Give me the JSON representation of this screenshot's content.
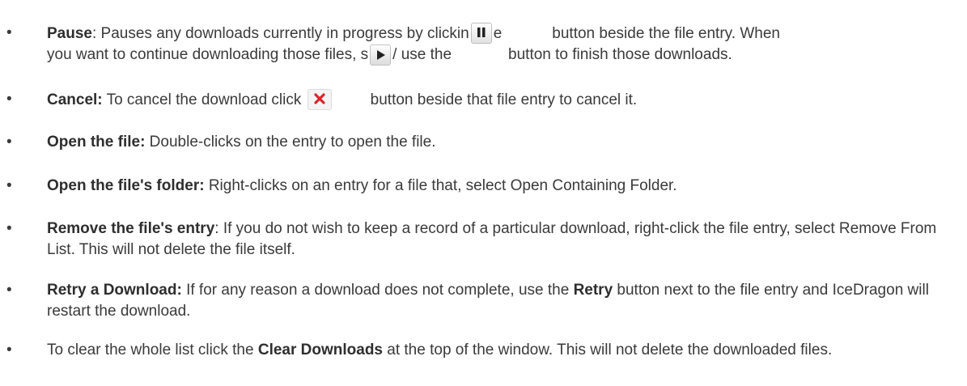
{
  "icons": {
    "pause": "pause-icon",
    "play": "play-icon",
    "cancel": "close-icon",
    "cancel_color": "#d9262c"
  },
  "items": [
    {
      "bold": "Pause",
      "t1": ": Pauses any downloads currently in progress by clickin",
      "t2": "e",
      "t3": "button beside the file entry. When",
      "t4": "you want to continue downloading those files, s",
      "t5": "/ use the",
      "t6": "button to finish those downloads."
    },
    {
      "bold": "Cancel:",
      "t1": " To cancel the download click",
      "t2": "button beside that file entry to cancel it."
    },
    {
      "bold": "Open the file:",
      "text": " Double-clicks on the entry to open the file."
    },
    {
      "bold": "Open the file's folder:",
      "text": " Right-clicks on an entry for a file that, select Open Containing Folder."
    },
    {
      "bold": "Remove the file's entry",
      "text": ": If you do not wish to keep a record of a particular download, right-click the file entry, select Remove From List. This will not delete the file itself."
    },
    {
      "bold": "Retry a Download:",
      "t1": " If for any reason a download does not complete, use the ",
      "bold2": "Retry",
      "t2": " button next to the file entry and IceDragon will restart the download."
    },
    {
      "t1": "To clear the whole list click the ",
      "bold": "Clear Downloads",
      "t2": " at the top of the window. This will not delete the downloaded files."
    }
  ]
}
